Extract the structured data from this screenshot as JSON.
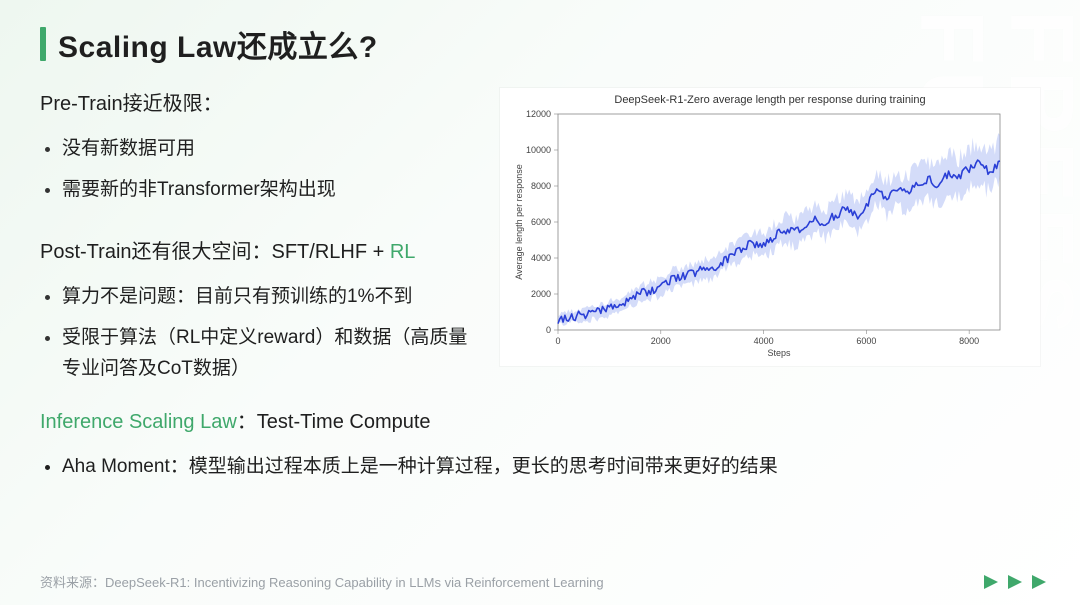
{
  "watermark": "FREES FUND",
  "title": "Scaling Law还成立么?",
  "section1": {
    "heading": "Pre-Train接近极限：",
    "bullets": [
      "没有新数据可用",
      "需要新的非Transformer架构出现"
    ]
  },
  "section2": {
    "heading_prefix": "Post-Train还有很大空间：SFT/RLHF + ",
    "heading_accent": "RL",
    "bullets": [
      "算力不是问题：目前只有预训练的1%不到",
      "受限于算法（RL中定义reward）和数据（高质量专业问答及CoT数据）"
    ]
  },
  "section3": {
    "heading_accent": "Inference Scaling Law",
    "heading_suffix": "：Test-Time Compute",
    "bullets": [
      "Aha Moment：模型输出过程本质上是一种计算过程，更长的思考时间带来更好的结果"
    ]
  },
  "source": "资料来源：DeepSeek-R1: Incentivizing Reasoning Capability in LLMs via Reinforcement Learning",
  "chart_data": {
    "type": "line",
    "title": "DeepSeek-R1-Zero average length per response during training",
    "xlabel": "Steps",
    "ylabel": "Average length per response",
    "xlim": [
      0,
      8600
    ],
    "ylim": [
      0,
      12000
    ],
    "x_ticks": [
      0,
      2000,
      4000,
      6000,
      8000
    ],
    "y_ticks": [
      0,
      2000,
      4000,
      6000,
      8000,
      10000,
      12000
    ],
    "series": [
      {
        "name": "mean",
        "color": "#2a3fd6",
        "x": [
          0,
          200,
          400,
          600,
          800,
          1000,
          1200,
          1400,
          1600,
          1800,
          2000,
          2200,
          2400,
          2600,
          2800,
          3000,
          3200,
          3400,
          3600,
          3800,
          4000,
          4200,
          4400,
          4600,
          4800,
          5000,
          5200,
          5400,
          5600,
          5800,
          6000,
          6200,
          6400,
          6600,
          6800,
          7000,
          7200,
          7400,
          7600,
          7800,
          8000,
          8200,
          8400,
          8600
        ],
        "values": [
          600,
          700,
          800,
          900,
          1000,
          1200,
          1400,
          1700,
          2000,
          2200,
          2400,
          2800,
          3000,
          3100,
          3400,
          3300,
          3800,
          4200,
          4600,
          4800,
          4700,
          5200,
          5600,
          5400,
          5800,
          6200,
          5900,
          6400,
          6700,
          6300,
          6900,
          7900,
          7300,
          7800,
          7500,
          8100,
          8400,
          8000,
          8700,
          8500,
          9000,
          9300,
          8800,
          9400
        ]
      },
      {
        "name": "noise_band",
        "color": "#9fb1f2",
        "amplitude": 1400
      }
    ]
  }
}
